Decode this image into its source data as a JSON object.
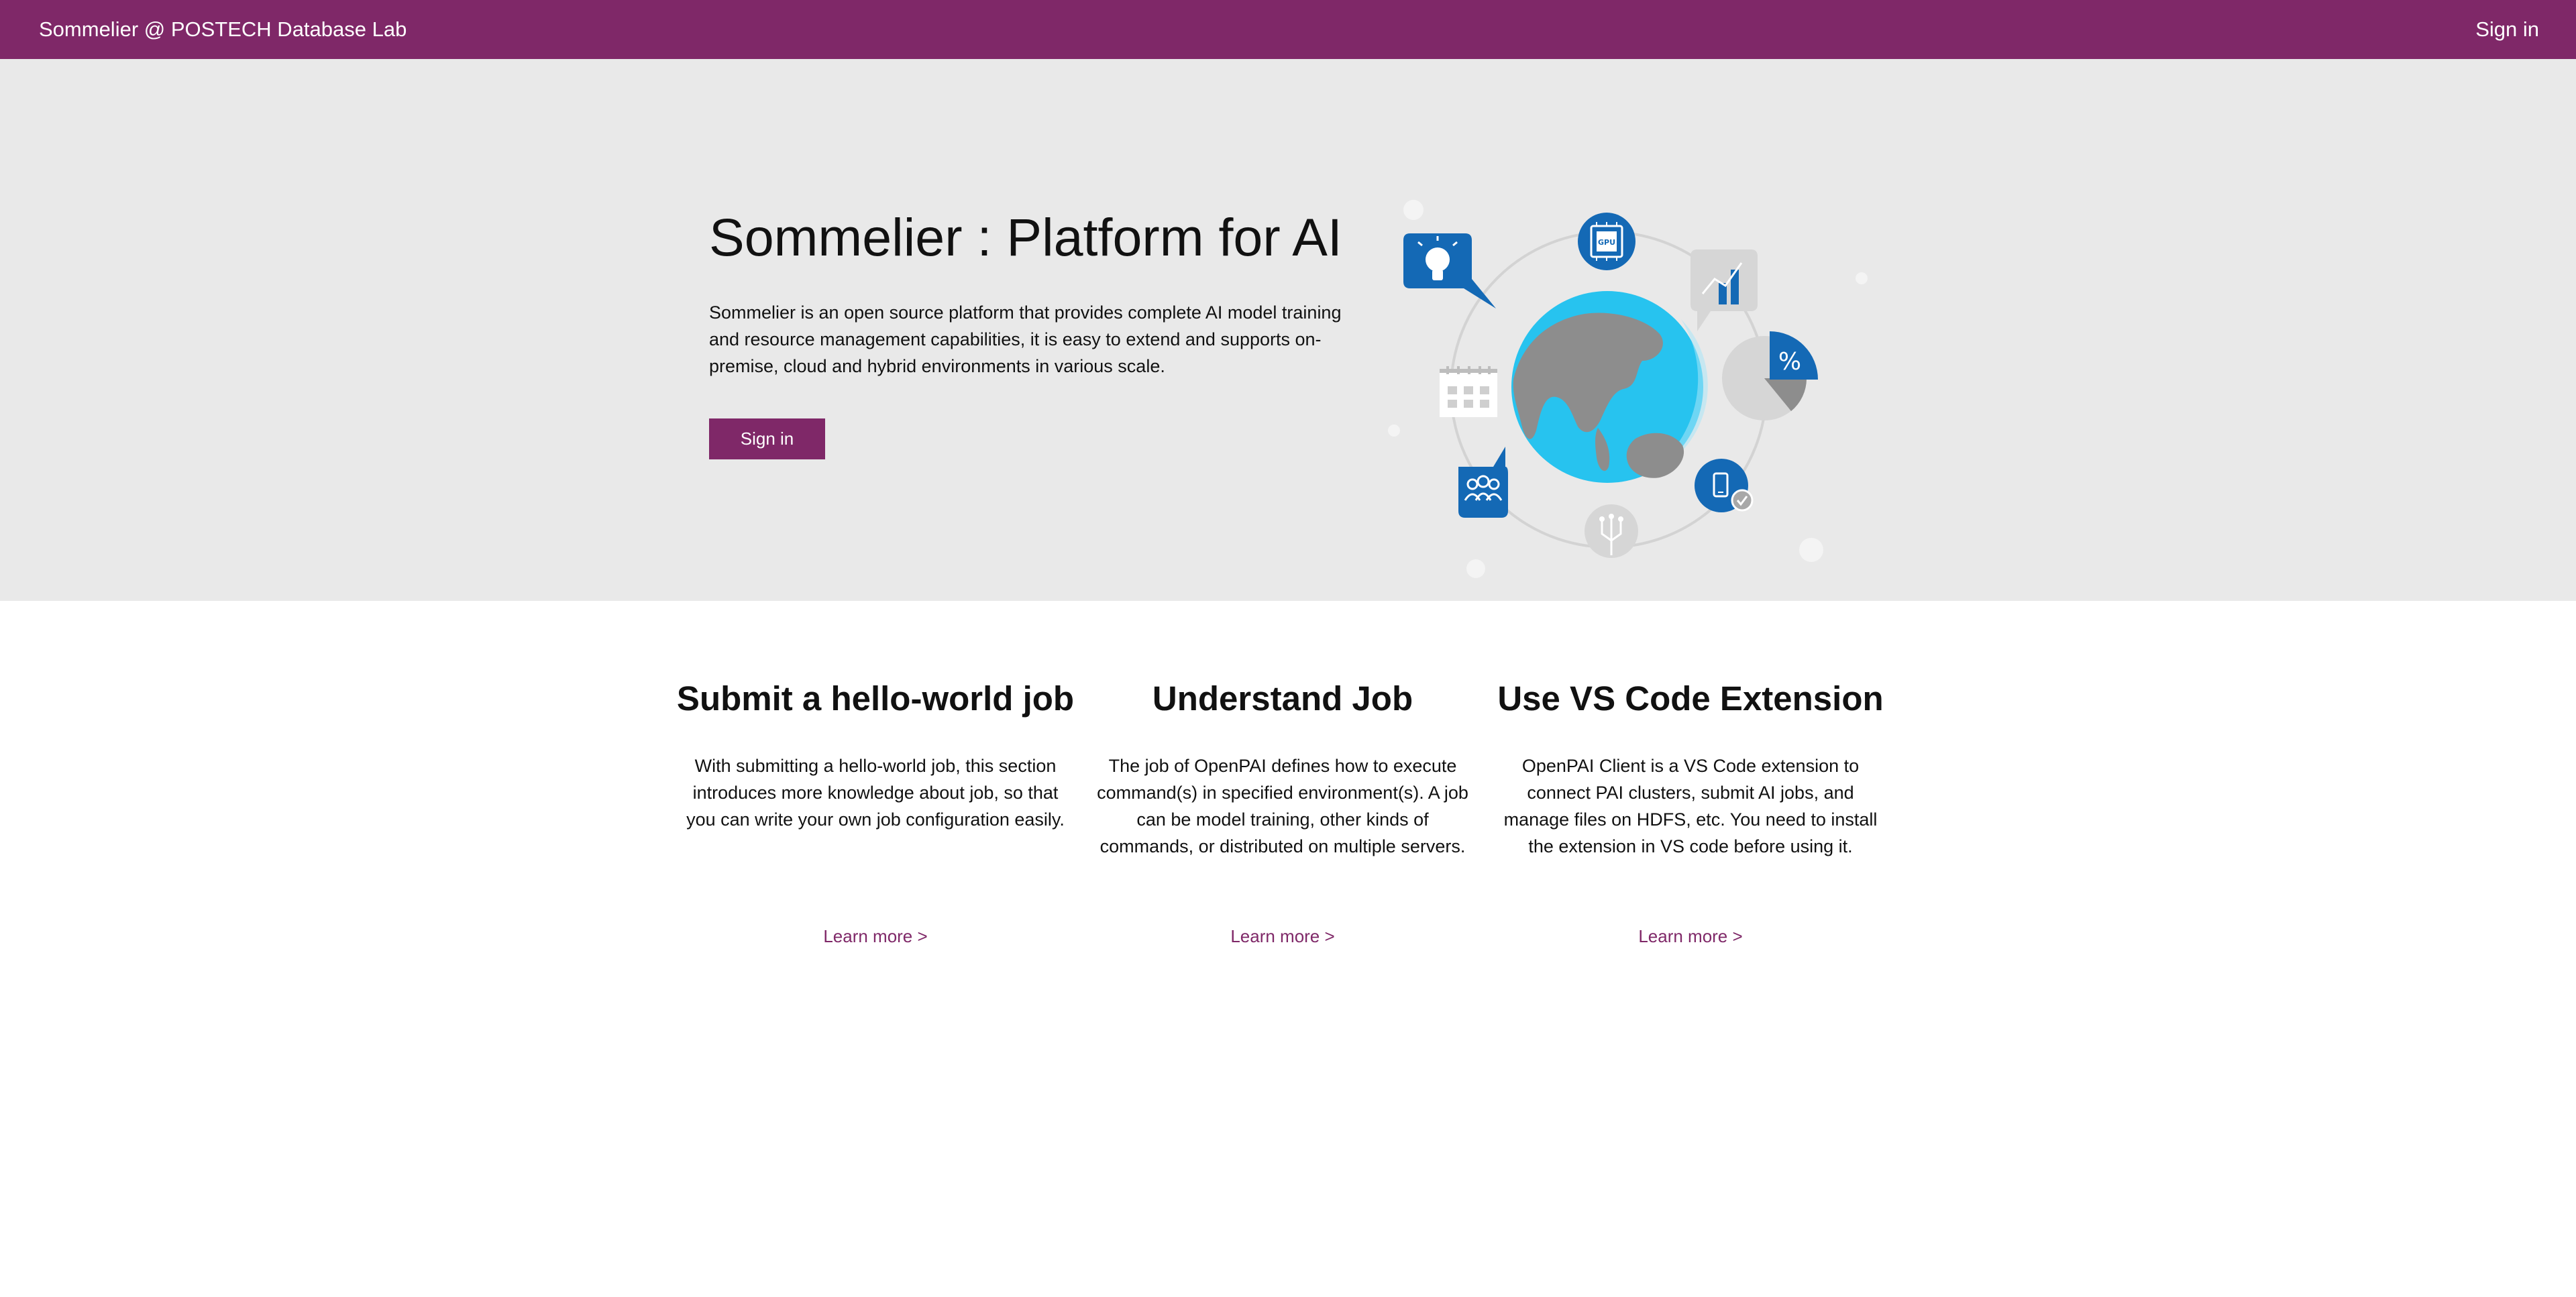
{
  "nav": {
    "brand": "Sommelier @ POSTECH Database Lab",
    "signin": "Sign in"
  },
  "hero": {
    "title": "Sommelier : Platform for AI",
    "description": "Sommelier is an open source platform that provides complete AI model training and resource management capabilities, it is easy to extend and supports on-premise, cloud and hybrid environments in various scale.",
    "signin_button": "Sign in",
    "illustration": {
      "icons": [
        "globe-icon",
        "lightbulb-icon",
        "gpu-chip-icon",
        "bar-chart-icon",
        "percent-pie-icon",
        "calendar-icon",
        "team-icon",
        "circuit-icon",
        "mobile-check-icon"
      ],
      "gpu_chip_label": "GPU",
      "percent_label": "%"
    }
  },
  "cards": [
    {
      "title": "Submit a hello-world job",
      "body": "With submitting a hello-world job, this section introduces more knowledge about job, so that you can write your own job configuration easily.",
      "link": "Learn more >"
    },
    {
      "title": "Understand Job",
      "body": "The job of OpenPAI defines how to execute command(s) in specified environment(s). A job can be model training, other kinds of commands, or distributed on multiple servers.",
      "link": "Learn more >"
    },
    {
      "title": "Use VS Code Extension",
      "body": "OpenPAI Client is a VS Code extension to connect PAI clusters, submit AI jobs, and manage files on HDFS, etc. You need to install the extension in VS code before using it.",
      "link": "Learn more >"
    }
  ],
  "colors": {
    "brand": "#7f2868",
    "hero_background": "#e9e9e9",
    "icon_blue": "#1469b5",
    "globe_cyan": "#27c3ef",
    "land_gray": "#8d8d8d"
  }
}
